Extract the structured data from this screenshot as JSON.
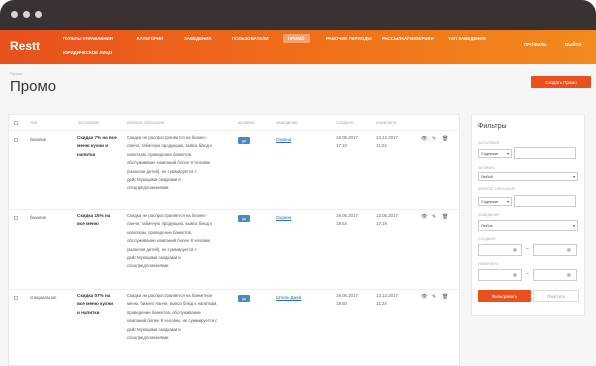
{
  "app": {
    "logo": "Restt"
  },
  "nav": {
    "items": [
      "Пульты управления",
      "Юридическое лицо",
      "Категории",
      "Заведения",
      "Пользователи",
      "Промо",
      "Рабочие периоды",
      "Рассылка/чеки/push",
      "Тип заведения"
    ],
    "active_index": 5,
    "right_items": [
      "Профиль",
      "Выйти"
    ]
  },
  "page": {
    "breadcrumb": "Промо",
    "title": "Промо",
    "create_button": "Создать Промо"
  },
  "table": {
    "columns": [
      "тип",
      "заголовок",
      "краткое описание",
      "активно",
      "заведение",
      "создано",
      "изменено"
    ],
    "rows": [
      {
        "type": "базовое",
        "title": "Скидка 7% на все меню кухни и напитки",
        "description": "Скидка не распространяется на бизнес-ланчи, табачную продукцию, вывоз блюд к напиткам, проведение банкетов, обслуживание компаний более 8 человек (включая детей), не суммируется с действующими скидками и спецпредложениями",
        "active": "да",
        "venue": "Охрана",
        "created": "18.05.2017 17:10",
        "modified": "13.12.2017 11:24"
      },
      {
        "type": "базовое",
        "title": "Скидка 15% на все меню",
        "description": "Скидка не распространяется на бизнес-ланчи, табачную продукцию, вывоз блюд к напиткам, проведение банкетов, обслуживание компаний более 8 человек (включая детей), не суммируется с действующими скидками и спецпредложениями",
        "active": "да",
        "venue": "Охрана",
        "created": "19.05.2017 18:54",
        "modified": "13.05.2017 17:19"
      },
      {
        "type": "специальное",
        "title": "Скидка 07% на все меню кухни и напитки",
        "description": "Скидка не распространяется на банкетное меню, бизнес-ланчи, вывоз блюд к напиткам, проведение банкетов, обслуживание компаний более 8 человек, не суммируется с действующими скидками и спецпредложениями",
        "active": "да",
        "venue": "Штиль Джей",
        "created": "19.05.2017 18:50",
        "modified": "13.12.2017 11:24"
      }
    ],
    "action_icons": [
      "eye-icon",
      "pencil-icon",
      "trash-icon"
    ]
  },
  "filters": {
    "title": "Фильтры",
    "fields": [
      {
        "label": "Заголовок",
        "select": "Содержит"
      },
      {
        "label": "Активно",
        "select": "Любой"
      },
      {
        "label": "Краткое описание",
        "select": "Содержит"
      },
      {
        "label": "Заведение",
        "select": "Любое"
      },
      {
        "label": "Создано"
      },
      {
        "label": "Изменено"
      }
    ],
    "apply_button": "Фильтровать",
    "clear_button": "Очистить"
  },
  "colors": {
    "accent": "#e8501e",
    "badge": "#4a88c7",
    "titlebar": "#3a3232"
  }
}
